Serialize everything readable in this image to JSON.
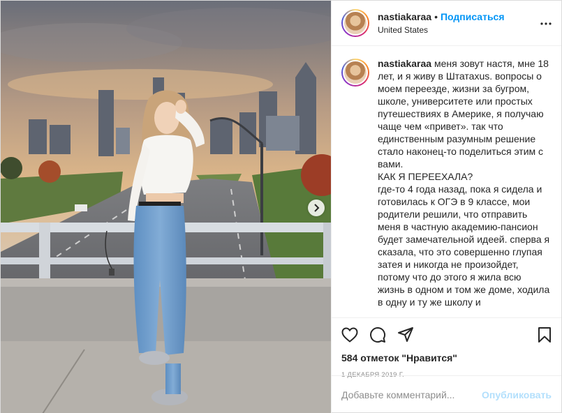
{
  "post": {
    "username": "nastiakaraa",
    "follow_label": "Подписаться",
    "separator": "•",
    "location": "United States"
  },
  "caption": {
    "username": "nastiakaraa",
    "text": " меня зовут настя, мне 18 лет, и я живу в Штатахus. вопросы о моем переезде, жизни за бугром, школе, университете или простых путешествиях в Америке, я получаю чаще чем «привет». так что единственным разумным решение стало наконец-то поделиться этим с вами.\nКАК Я ПЕРЕЕХАЛА?\nгде-то 4 года назад, пока я сидела и готовилась к ОГЭ в 9 классе, мои родители решили, что отправить меня в частную академию-пансион будет замечательной идеей. сперва я сказала, что это совершенно глупая затея и никогда не произойдет, потому что до этого я жила всю жизнь в одном и том же доме, ходила в одну и ту же школу и"
  },
  "engagement": {
    "likes": "584 отметок \"Нравится\"",
    "date": "1 ДЕКАБРЯ 2019 Г."
  },
  "comment_box": {
    "placeholder": "Добавьте комментарий...",
    "publish_label": "Опубликовать"
  },
  "icons": {
    "like": "heart-icon",
    "comment": "comment-icon",
    "share": "share-icon",
    "save": "bookmark-icon",
    "more": "more-dots-icon",
    "next": "chevron-right-icon"
  },
  "colors": {
    "link_blue": "#0095f6",
    "publish_disabled": "#b2dffc",
    "muted": "#8e8e8e",
    "text": "#262626"
  }
}
